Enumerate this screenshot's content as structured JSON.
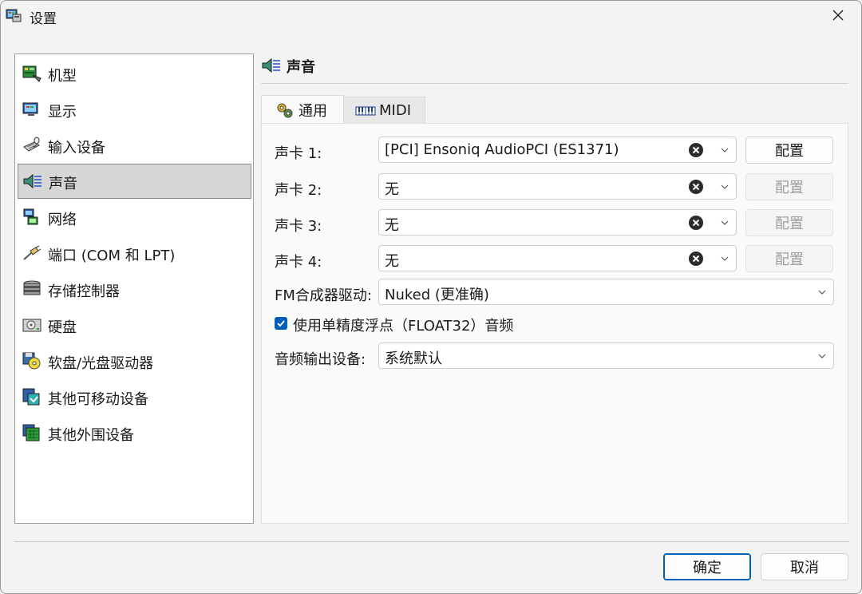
{
  "window": {
    "title": "设置",
    "app_icon": "settings-app-icon",
    "close_icon": "close-icon"
  },
  "sidebar": {
    "items": [
      {
        "label": "机型",
        "icon": "machine-icon"
      },
      {
        "label": "显示",
        "icon": "display-icon"
      },
      {
        "label": "输入设备",
        "icon": "input-devices-icon"
      },
      {
        "label": "声音",
        "icon": "sound-icon",
        "selected": true
      },
      {
        "label": "网络",
        "icon": "network-icon"
      },
      {
        "label": "端口 (COM 和 LPT)",
        "icon": "ports-icon"
      },
      {
        "label": "存储控制器",
        "icon": "storage-controllers-icon"
      },
      {
        "label": "硬盘",
        "icon": "hard-disk-icon"
      },
      {
        "label": "软盘/光盘驱动器",
        "icon": "floppy-cdrom-icon"
      },
      {
        "label": "其他可移动设备",
        "icon": "removable-devices-icon"
      },
      {
        "label": "其他外围设备",
        "icon": "peripherals-icon"
      }
    ]
  },
  "header": {
    "title": "声音",
    "icon": "sound-icon"
  },
  "tabs": [
    {
      "label": "通用",
      "icon": "gears-icon",
      "active": true
    },
    {
      "label": "MIDI",
      "icon": "midi-keyboard-icon",
      "active": false
    }
  ],
  "sound_cards": [
    {
      "label": "声卡 1:",
      "value": "[PCI] Ensoniq AudioPCI (ES1371)",
      "button": "配置",
      "button_enabled": true
    },
    {
      "label": "声卡 2:",
      "value": "无",
      "button": "配置",
      "button_enabled": false
    },
    {
      "label": "声卡 3:",
      "value": "无",
      "button": "配置",
      "button_enabled": false
    },
    {
      "label": "声卡 4:",
      "value": "无",
      "button": "配置",
      "button_enabled": false
    }
  ],
  "fm_synth": {
    "label": "FM合成器驱动:",
    "value": "Nuked (更准确)"
  },
  "float32": {
    "label": "使用单精度浮点（FLOAT32）音频",
    "checked": true
  },
  "audio_output": {
    "label": "音频输出设备:",
    "value": "系统默认"
  },
  "footer": {
    "ok": "确定",
    "cancel": "取消"
  },
  "colors": {
    "accent": "#005fb8",
    "selected_bg": "#d6d6d6",
    "disabled_text": "#9f9f9f"
  }
}
